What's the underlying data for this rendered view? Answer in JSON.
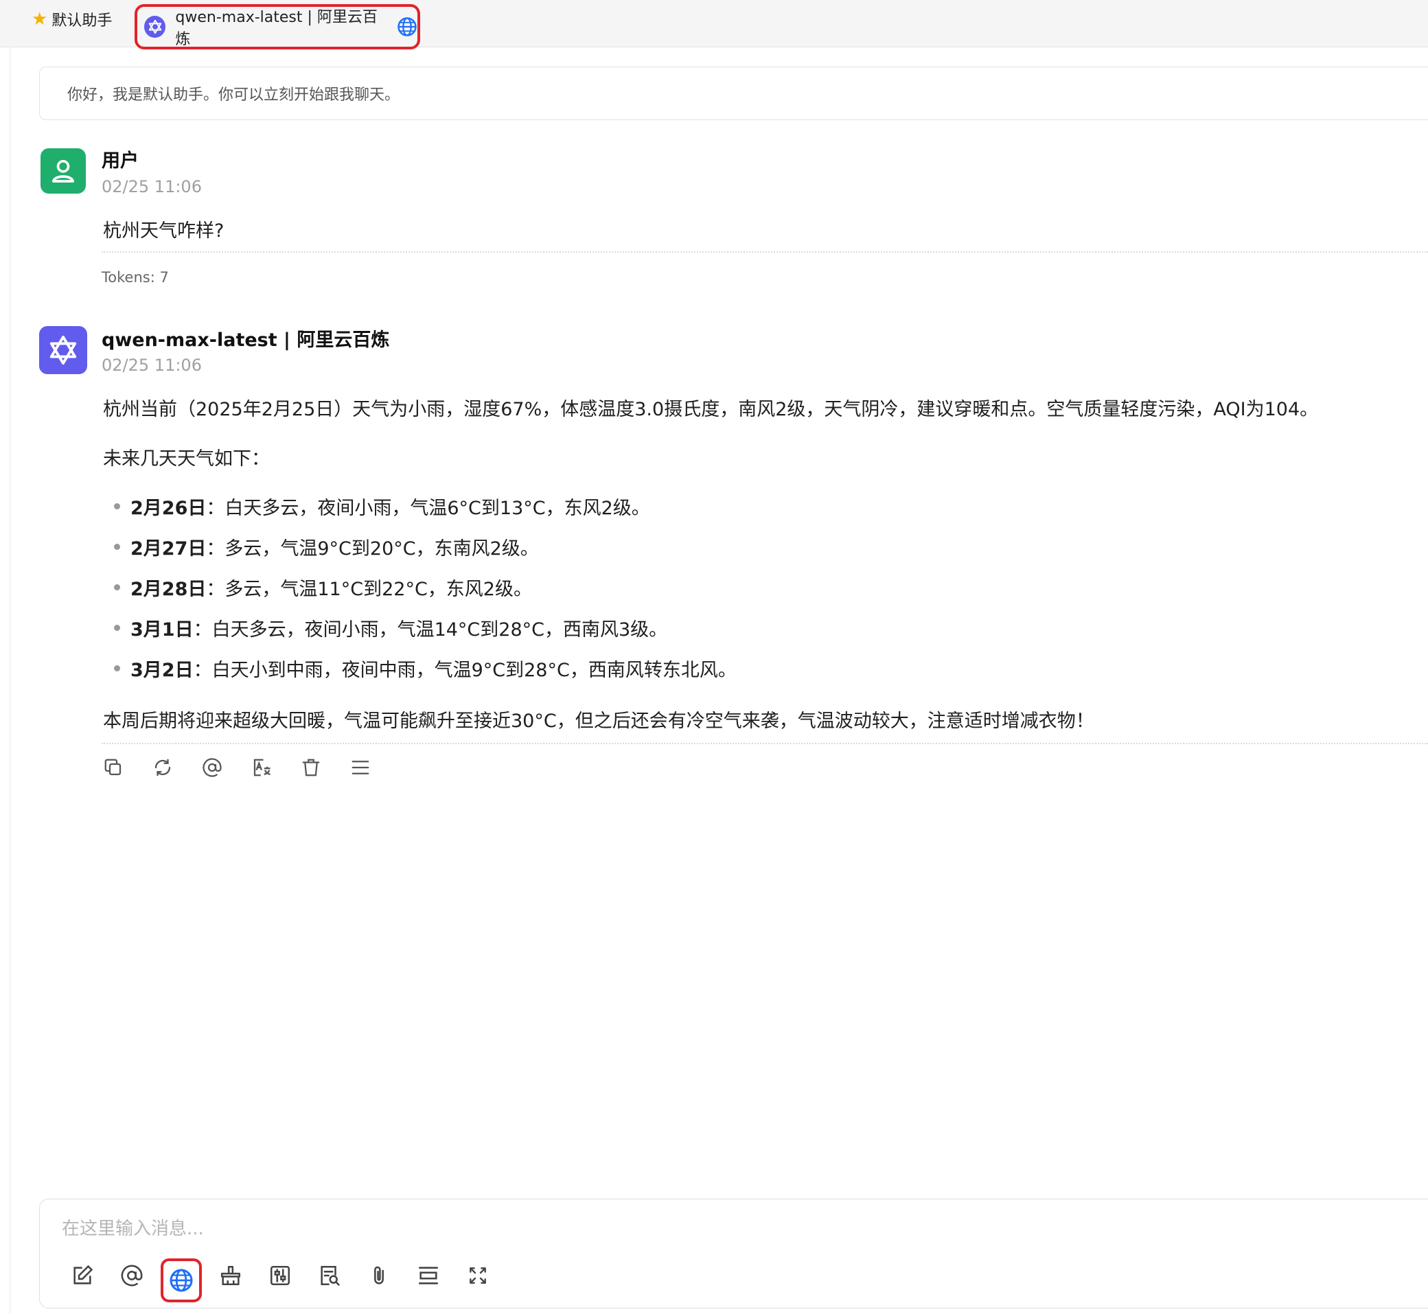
{
  "tabs": [
    {
      "label": "默认助手",
      "icon": "star-icon"
    },
    {
      "label": "qwen-max-latest | 阿里云百炼",
      "icon": "qwen-logo-icon",
      "badge_icon": "globe-icon"
    }
  ],
  "greeting": "你好，我是默认助手。你可以立刻开始跟我聊天。",
  "user_message": {
    "name": "用户",
    "time": "02/25 11:06",
    "text": "杭州天气咋样?",
    "tokens": "Tokens: 7"
  },
  "assistant_message": {
    "name": "qwen-max-latest | 阿里云百炼",
    "time": "02/25 11:06",
    "intro": "杭州当前（2025年2月25日）天气为小雨，湿度67%，体感温度3.0摄氏度，南风2级，天气阴冷，建议穿暖和点。空气质量轻度污染，AQI为104。",
    "forecast_heading": "未来几天天气如下：",
    "forecast": [
      {
        "date": "2月26日",
        "text": "：白天多云，夜间小雨，气温6°C到13°C，东风2级。"
      },
      {
        "date": "2月27日",
        "text": "：多云，气温9°C到20°C，东南风2级。"
      },
      {
        "date": "2月28日",
        "text": "：多云，气温11°C到22°C，东风2级。"
      },
      {
        "date": "3月1日",
        "text": "：白天多云，夜间小雨，气温14°C到28°C，西南风3级。"
      },
      {
        "date": "3月2日",
        "text": "：白天小到中雨，夜间中雨，气温9°C到28°C，西南风转东北风。"
      }
    ],
    "closing": "本周后期将迎来超级大回暖，气温可能飙升至接近30°C，但之后还会有冷空气来袭，气温波动较大，注意适时增减衣物！"
  },
  "message_actions": [
    "copy-icon",
    "regenerate-icon",
    "mention-icon",
    "translate-icon",
    "delete-icon",
    "menu-icon"
  ],
  "composer": {
    "placeholder": "在这里输入消息...",
    "tools": [
      "new-topic-icon",
      "mention-icon",
      "web-search-icon",
      "clear-icon",
      "settings-icon",
      "knowledge-icon",
      "attachment-icon",
      "layout-icon",
      "expand-icon"
    ],
    "active_tool": "web-search-icon"
  },
  "colors": {
    "accent_red": "#e0242a",
    "qwen_purple": "#615ced",
    "user_green": "#1fae6b",
    "globe_blue": "#1e6ff5"
  }
}
